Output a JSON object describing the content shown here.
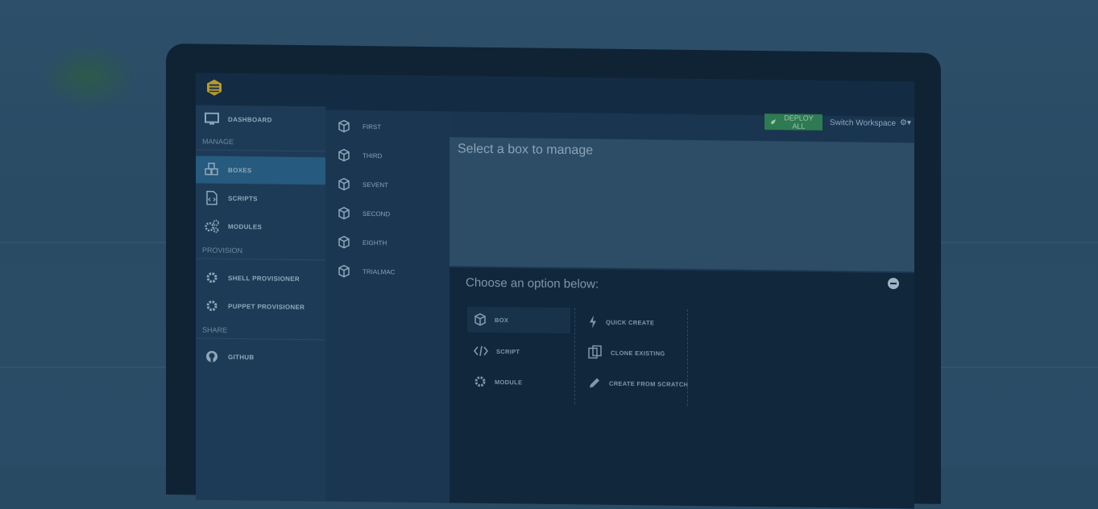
{
  "sidebar": {
    "items": [
      {
        "label": "DASHBOARD",
        "icon": "monitor-icon"
      },
      {
        "label": "BOXES",
        "icon": "cubes-icon"
      },
      {
        "label": "SCRIPTS",
        "icon": "file-code-icon"
      },
      {
        "label": "MODULES",
        "icon": "gears-icon"
      },
      {
        "label": "SHELL PROVISIONER",
        "icon": "gear-icon"
      },
      {
        "label": "PUPPET PROVISIONER",
        "icon": "gear-icon"
      },
      {
        "label": "GITHUB",
        "icon": "github-icon"
      }
    ],
    "headings": {
      "manage": "MANAGE",
      "provision": "PROVISION",
      "share": "SHARE"
    }
  },
  "boxlist": {
    "items": [
      "FIRST",
      "THIRD",
      "SEVENT",
      "SECOND",
      "EIGHTH",
      "TRIALMAC"
    ]
  },
  "header": {
    "deploy_label": "DEPLOY ALL",
    "switch_workspace": "Switch Workspace",
    "settings_caret": "▾"
  },
  "main": {
    "manage_title": "Select a box to manage",
    "option_title": "Choose an option below:",
    "type_options": [
      {
        "label": "BOX",
        "icon": "cube-icon"
      },
      {
        "label": "SCRIPT",
        "icon": "code-icon"
      },
      {
        "label": "MODULE",
        "icon": "gear-icon"
      }
    ],
    "create_options": [
      {
        "label": "QUICK CREATE",
        "icon": "bolt-icon"
      },
      {
        "label": "CLONE EXISTING",
        "icon": "copy-icon"
      },
      {
        "label": "CREATE FROM SCRATCH",
        "icon": "pencil-icon"
      }
    ]
  },
  "colors": {
    "overlay": "#294a63",
    "accent": "#265a7e",
    "deploy_green": "#2e7a52"
  }
}
